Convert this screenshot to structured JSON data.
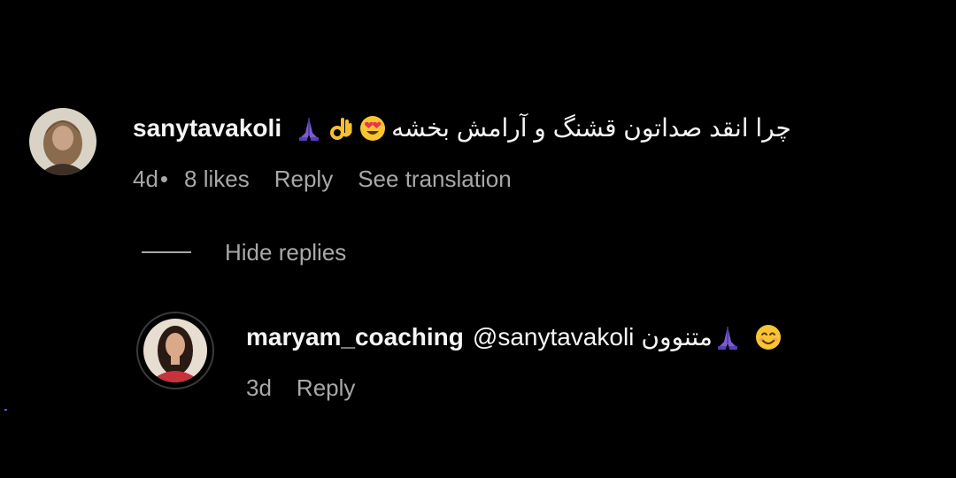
{
  "comment": {
    "username": "sanytavakoli",
    "text": "چرا انقد صداتون قشنگ و آرامش بخشه",
    "emojis": [
      "folded-hands-icon",
      "ok-hand-icon",
      "heart-eyes-icon"
    ],
    "age": "4d",
    "likes": "8 likes",
    "reply_label": "Reply",
    "translate_label": "See translation"
  },
  "toggle": {
    "label": "Hide replies"
  },
  "reply": {
    "username": "maryam_coaching",
    "mention": "@sanytavakoli",
    "text": "متنوون",
    "emojis": [
      "folded-hands-icon",
      "smiling-face-icon"
    ],
    "age": "3d",
    "reply_label": "Reply"
  },
  "colors": {
    "background": "#000000",
    "primary_text": "#f5f5f5",
    "secondary_text": "#a8a8a8"
  }
}
